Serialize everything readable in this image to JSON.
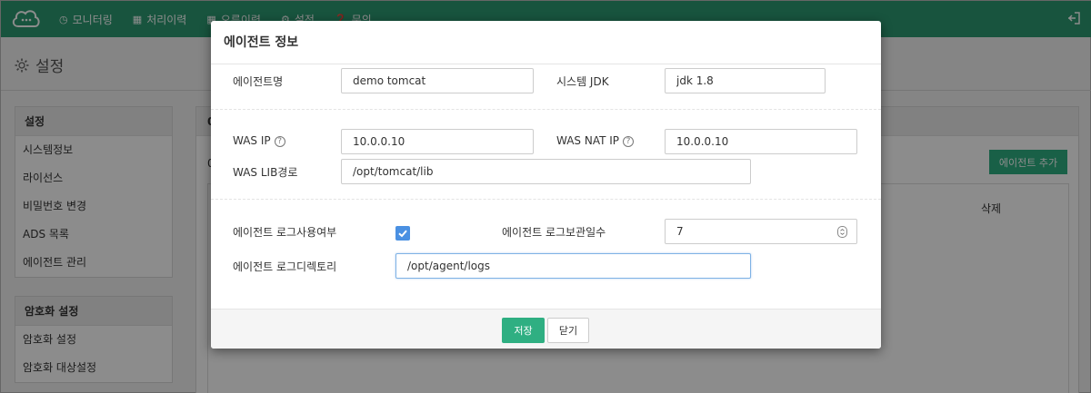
{
  "colors": {
    "brand": "#2c9a72",
    "primary_button": "#2faf82",
    "checkbox": "#4a90e2"
  },
  "nav": {
    "items": [
      {
        "icon": "dashboard-icon",
        "label": "모니터링"
      },
      {
        "icon": "table-icon",
        "label": "처리이력"
      },
      {
        "icon": "table-icon",
        "label": "오류이력"
      },
      {
        "icon": "gear-icon",
        "label": "설정"
      },
      {
        "icon": "question-icon",
        "label": "문의"
      }
    ]
  },
  "page": {
    "title": "설정"
  },
  "sidebar": {
    "settings": {
      "header": "설정",
      "items": [
        "시스템정보",
        "라이선스",
        "비밀번호 변경",
        "ADS 목록",
        "에이전트 관리"
      ]
    },
    "encryption": {
      "header": "암호화 설정",
      "items": [
        "암호화 설정",
        "암호화 대상설정"
      ]
    }
  },
  "content": {
    "header_partial": "0",
    "row_partial": "0",
    "add_button": "에이전트 추가",
    "col_delete": "삭제"
  },
  "modal": {
    "title": "에이전트 정보",
    "agent_name_label": "에이전트명",
    "agent_name_value": "demo tomcat",
    "jdk_label": "시스템 JDK",
    "jdk_value": "jdk 1.8",
    "was_ip_label": "WAS IP",
    "was_ip_value": "10.0.0.10",
    "was_nat_ip_label": "WAS NAT IP",
    "was_nat_ip_value": "10.0.0.10",
    "was_lib_label": "WAS LIB경로",
    "was_lib_value": "/opt/tomcat/lib",
    "log_use_label": "에이전트 로그사용여부",
    "log_use_checked": true,
    "log_days_label": "에이전트 로그보관일수",
    "log_days_value": "7",
    "log_dir_label": "에이전트 로그디렉토리",
    "log_dir_value": "/opt/agent/logs",
    "save_button": "저장",
    "close_button": "닫기"
  }
}
